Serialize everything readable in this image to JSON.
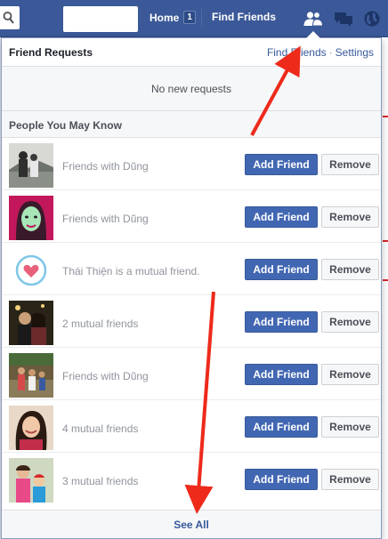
{
  "nav": {
    "home_label": "Home",
    "home_count": "1",
    "find_friends_label": "Find Friends"
  },
  "panel": {
    "title": "Friend Requests",
    "find_friends_link": "Find Friends",
    "separator": "·",
    "settings_link": "Settings",
    "empty_text": "No new requests",
    "section_title": "People You May Know",
    "see_all": "See All",
    "people": [
      {
        "subtitle": "Friends with Dũng",
        "add": "Add Friend",
        "remove": "Remove",
        "photo": "couple-gray"
      },
      {
        "subtitle": "Friends with Dũng",
        "add": "Add Friend",
        "remove": "Remove",
        "photo": "illustrated-face"
      },
      {
        "subtitle": "Thái Thiện is a mutual friend.",
        "add": "Add Friend",
        "remove": "Remove",
        "photo": "heart-logo"
      },
      {
        "subtitle": "2 mutual friends",
        "add": "Add Friend",
        "remove": "Remove",
        "photo": "couple-night"
      },
      {
        "subtitle": "Friends with Dũng",
        "add": "Add Friend",
        "remove": "Remove",
        "photo": "people-outdoor"
      },
      {
        "subtitle": "4 mutual friends",
        "add": "Add Friend",
        "remove": "Remove",
        "photo": "woman-smiling"
      },
      {
        "subtitle": "3 mutual friends",
        "add": "Add Friend",
        "remove": "Remove",
        "photo": "mother-child"
      }
    ]
  },
  "colors": {
    "topbar": "#3b5998",
    "primary_button": "#4267b2",
    "link": "#365899",
    "annotation_arrow": "#ee2a1b"
  },
  "icons": [
    "search-icon",
    "friend-requests-icon",
    "messages-icon",
    "notifications-globe-icon"
  ]
}
